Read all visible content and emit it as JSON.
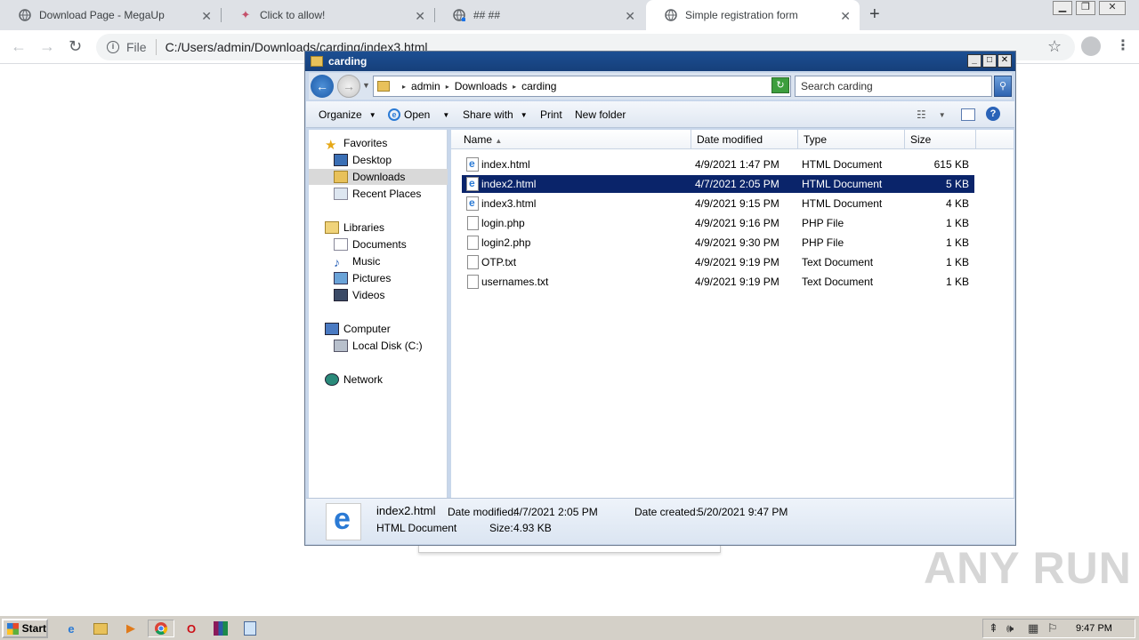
{
  "browser": {
    "tabs": [
      {
        "title": "Download Page - MegaUp",
        "favicon": "globe-icon"
      },
      {
        "title": "Click to allow!",
        "favicon": "puzzle-icon"
      },
      {
        "title": "## ##",
        "favicon": "globe-icon"
      },
      {
        "title": "Simple registration form",
        "favicon": "globe-icon",
        "active": true
      }
    ],
    "new_tab": "+",
    "omnibox": {
      "scheme_label": "File",
      "url": "C:/Users/admin/Downloads/carding/index3.html"
    }
  },
  "explorer": {
    "title": "carding",
    "breadcrumb": [
      "admin",
      "Downloads",
      "carding"
    ],
    "search_placeholder": "Search carding",
    "commands": {
      "organize": "Organize",
      "open": "Open",
      "share_with": "Share with",
      "print": "Print",
      "new_folder": "New folder"
    },
    "nav": {
      "favorites": "Favorites",
      "desktop": "Desktop",
      "downloads": "Downloads",
      "recent_places": "Recent Places",
      "libraries": "Libraries",
      "documents": "Documents",
      "music": "Music",
      "pictures": "Pictures",
      "videos": "Videos",
      "computer": "Computer",
      "local_disk": "Local Disk (C:)",
      "network": "Network"
    },
    "columns": {
      "name": "Name",
      "date": "Date modified",
      "type": "Type",
      "size": "Size"
    },
    "files": [
      {
        "name": "index.html",
        "date": "4/9/2021 1:47 PM",
        "type": "HTML Document",
        "size": "615 KB",
        "icon": "ie-document-icon"
      },
      {
        "name": "index2.html",
        "date": "4/7/2021 2:05 PM",
        "type": "HTML Document",
        "size": "5 KB",
        "icon": "ie-document-icon",
        "selected": true
      },
      {
        "name": "index3.html",
        "date": "4/9/2021 9:15 PM",
        "type": "HTML Document",
        "size": "4 KB",
        "icon": "ie-document-icon"
      },
      {
        "name": "login.php",
        "date": "4/9/2021 9:16 PM",
        "type": "PHP File",
        "size": "1 KB",
        "icon": "file-icon"
      },
      {
        "name": "login2.php",
        "date": "4/9/2021 9:30 PM",
        "type": "PHP File",
        "size": "1 KB",
        "icon": "file-icon"
      },
      {
        "name": "OTP.txt",
        "date": "4/9/2021 9:19 PM",
        "type": "Text Document",
        "size": "1 KB",
        "icon": "file-icon"
      },
      {
        "name": "usernames.txt",
        "date": "4/9/2021 9:19 PM",
        "type": "Text Document",
        "size": "1 KB",
        "icon": "file-icon"
      }
    ],
    "details": {
      "name": "index2.html",
      "type": "HTML Document",
      "date_modified_label": "Date modified:",
      "date_modified": "4/7/2021 2:05 PM",
      "size_label": "Size:",
      "size": "4.93 KB",
      "date_created_label": "Date created:",
      "date_created": "5/20/2021 9:47 PM"
    }
  },
  "watermark": "ANY RUN",
  "taskbar": {
    "start": "Start",
    "clock": "9:47 PM"
  },
  "colors": {
    "selection": "#0a246a",
    "titlebar": "#1c4f93"
  }
}
